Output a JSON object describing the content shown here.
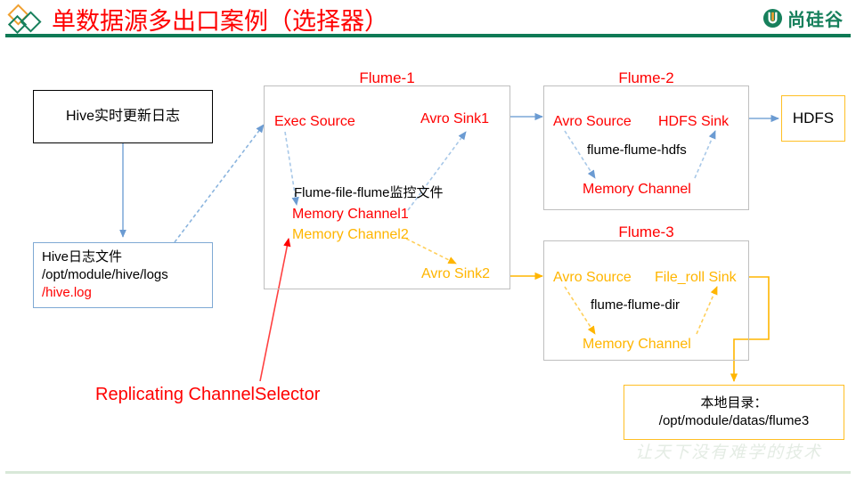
{
  "header": {
    "title": "单数据源多出口案例（选择器）",
    "brand_name": "尚硅谷",
    "brand_mark": "u-circle-icon",
    "diamond_logo": "double-diamond-icon",
    "rule_color": "#0f7a55"
  },
  "nodes": {
    "hive_source": {
      "label": "Hive实时更新日志",
      "border_color": "#000000"
    },
    "hive_logfile": {
      "line1": "Hive日志文件",
      "line2": "/opt/module/hive/logs",
      "line3": "/hive.log",
      "border_color": "#7fa9d4",
      "line3_color": "#ff0000"
    },
    "hdfs": {
      "label": "HDFS",
      "border_color": "#ffbf24"
    },
    "local_dir": {
      "line1": "本地目录：",
      "line2": "/opt/module/datas/flume3",
      "border_color": "#ffbf24"
    }
  },
  "agents": {
    "flume1": {
      "title": "Flume-1",
      "source": "Exec Source",
      "sink1": "Avro Sink1",
      "sink2": "Avro Sink2",
      "config_name": "Flume-file-flume监控文件",
      "channel1": "Memory  Channel1",
      "channel2": "Memory  Channel2",
      "channel1_color": "#ff0000",
      "channel2_color": "#ffb500"
    },
    "flume2": {
      "title": "Flume-2",
      "source": "Avro Source",
      "sink": "HDFS Sink",
      "config_name": "flume-flume-hdfs",
      "channel": "Memory Channel",
      "accent_color": "#ff0000"
    },
    "flume3": {
      "title": "Flume-3",
      "source": "Avro Source",
      "sink": "File_roll Sink",
      "config_name": "flume-flume-dir",
      "channel": "Memory Channel",
      "accent_color": "#ffb500"
    }
  },
  "annotation": {
    "channel_selector": "Replicating ChannelSelector",
    "color": "#ff0000"
  },
  "watermark": {
    "text": "让天下没有难学的技术"
  },
  "colors": {
    "red": "#ff0000",
    "gold": "#ffb500",
    "blue_arrow": "#7ba7d7",
    "green": "#0f7a55",
    "gray_border": "#bfbfbf"
  }
}
